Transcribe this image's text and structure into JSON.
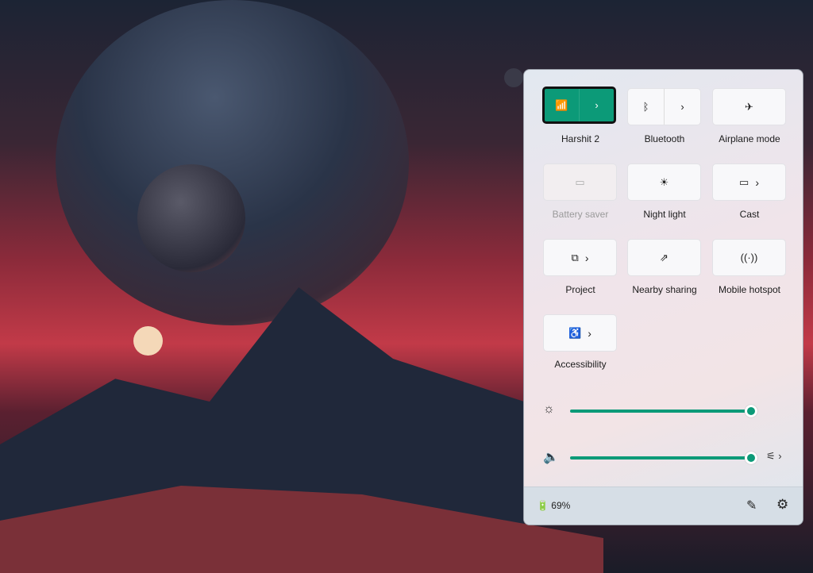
{
  "tiles": [
    {
      "label": "Harshit 2",
      "icon": "wifi-icon",
      "state": "on"
    },
    {
      "label": "Bluetooth",
      "icon": "bluetooth-icon",
      "state": "off"
    },
    {
      "label": "Airplane mode",
      "icon": "airplane-icon",
      "state": "off"
    },
    {
      "label": "Battery saver",
      "icon": "battery-saver-icon",
      "state": "disabled"
    },
    {
      "label": "Night light",
      "icon": "night-light-icon",
      "state": "off"
    },
    {
      "label": "Cast",
      "icon": "cast-icon",
      "state": "off"
    },
    {
      "label": "Project",
      "icon": "project-icon",
      "state": "off"
    },
    {
      "label": "Nearby sharing",
      "icon": "share-icon",
      "state": "off"
    },
    {
      "label": "Mobile hotspot",
      "icon": "hotspot-icon",
      "state": "off"
    },
    {
      "label": "Accessibility",
      "icon": "accessibility-icon",
      "state": "off"
    }
  ],
  "brightness": 100,
  "volume": 100,
  "battery": {
    "text": "69%"
  },
  "accent": "#0c9a78"
}
